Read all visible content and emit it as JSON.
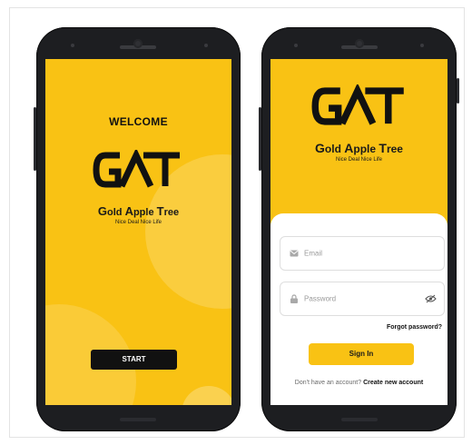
{
  "colors": {
    "accent": "#f9c214",
    "dark": "#111111",
    "phone_body": "#1d1e21"
  },
  "brand": {
    "logo_text": "GAT",
    "name_parts": [
      "G",
      "old ",
      "A",
      "pple ",
      "T",
      "ree"
    ],
    "tagline": "Nice Deal Nice Life"
  },
  "splash": {
    "welcome": "WELCOME",
    "start_label": "START"
  },
  "login": {
    "email_placeholder": "Email",
    "password_placeholder": "Password",
    "forgot_label": "Forgot password?",
    "signin_label": "Sign In",
    "no_account_text": "Don't have an account?",
    "create_account_label": "Create new account"
  },
  "icons": [
    "mail-icon",
    "lock-icon",
    "eye-off-icon",
    "camera-icon",
    "speaker-icon"
  ]
}
